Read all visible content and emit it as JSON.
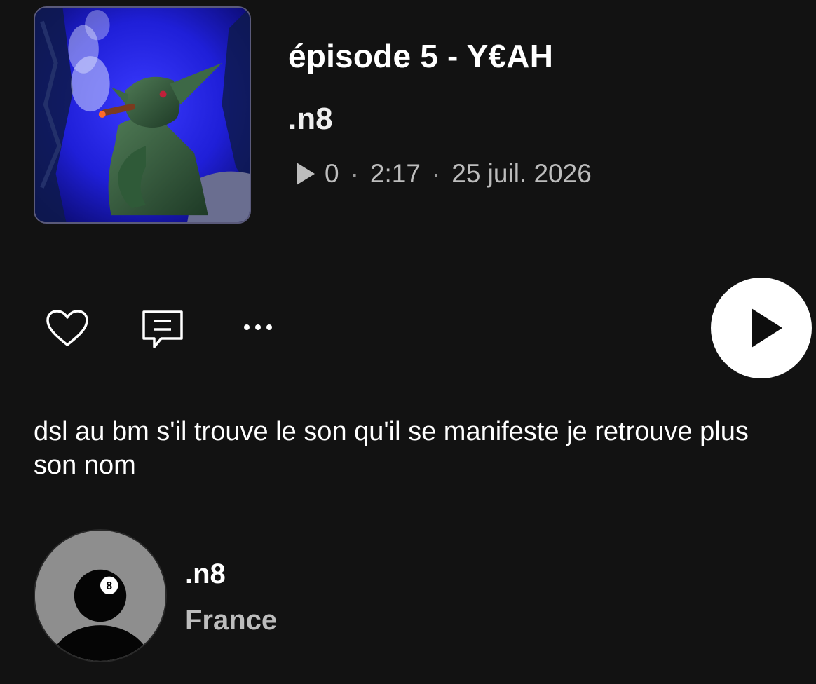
{
  "episode": {
    "title": "épisode 5 - Y€AH",
    "artist": ".n8",
    "plays": "0",
    "duration": "2:17",
    "date": "25 juil. 2026",
    "separator": "·",
    "cover_art": "goblin-smoking-cigar-blue-background"
  },
  "actions": {
    "like_icon": "heart-icon",
    "comment_icon": "comment-icon",
    "more_icon": "more-dots-icon",
    "play_icon": "play-icon"
  },
  "description": "dsl au bm s'il trouve le son qu'il se manifeste je retrouve plus son nom",
  "user": {
    "name": ".n8",
    "country": "France",
    "avatar": "eight-ball-avatar"
  },
  "colors": {
    "background": "#121212",
    "text_primary": "#ffffff",
    "text_secondary": "#bdbdbd",
    "play_button": "#ffffff"
  }
}
